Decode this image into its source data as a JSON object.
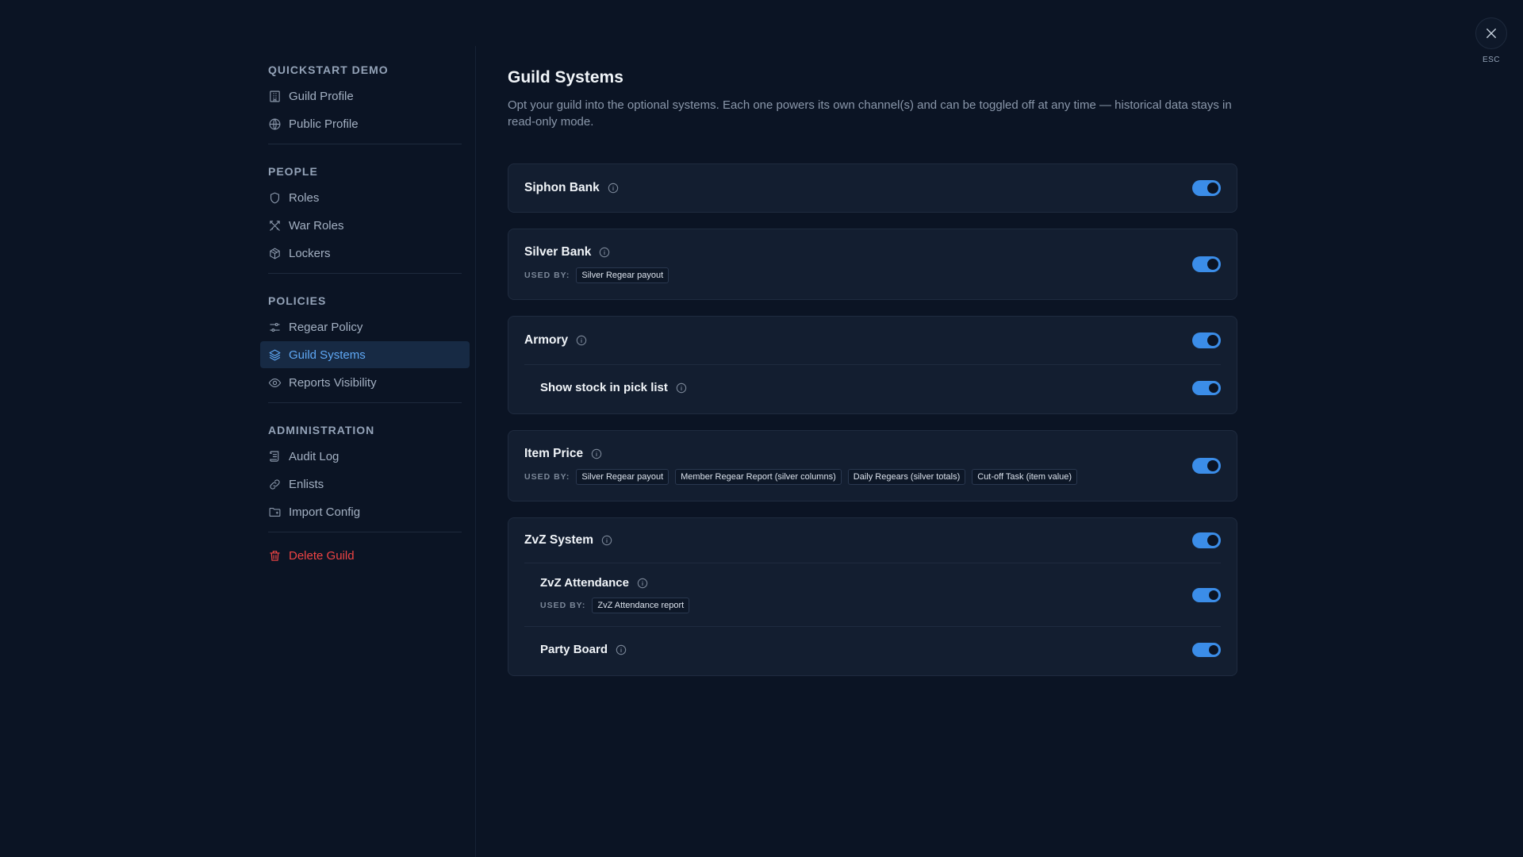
{
  "close": {
    "esc_label": "ESC"
  },
  "sidebar": {
    "sections": [
      {
        "title": "QUICKSTART DEMO",
        "items": [
          {
            "label": "Guild Profile",
            "icon": "building-icon"
          },
          {
            "label": "Public Profile",
            "icon": "globe-icon"
          }
        ]
      },
      {
        "title": "PEOPLE",
        "items": [
          {
            "label": "Roles",
            "icon": "shield-icon"
          },
          {
            "label": "War Roles",
            "icon": "swords-icon"
          },
          {
            "label": "Lockers",
            "icon": "box-icon"
          }
        ]
      },
      {
        "title": "POLICIES",
        "items": [
          {
            "label": "Regear Policy",
            "icon": "sliders-icon"
          },
          {
            "label": "Guild Systems",
            "icon": "layers-icon",
            "active": true
          },
          {
            "label": "Reports Visibility",
            "icon": "eye-icon"
          }
        ]
      },
      {
        "title": "ADMINISTRATION",
        "items": [
          {
            "label": "Audit Log",
            "icon": "scroll-icon"
          },
          {
            "label": "Enlists",
            "icon": "link-icon"
          },
          {
            "label": "Import Config",
            "icon": "folder-icon"
          }
        ]
      }
    ],
    "delete_label": "Delete Guild"
  },
  "main": {
    "title": "Guild Systems",
    "description": "Opt your guild into the optional systems. Each one powers its own channel(s) and can be toggled off at any time — historical data stays in read-only mode.",
    "used_by_label": "USED BY:",
    "systems": {
      "siphon_bank": {
        "name": "Siphon Bank",
        "enabled": true
      },
      "silver_bank": {
        "name": "Silver Bank",
        "enabled": true,
        "used_by": [
          "Silver Regear payout"
        ]
      },
      "armory": {
        "name": "Armory",
        "enabled": true,
        "sub": {
          "name": "Show stock in pick list",
          "enabled": true
        }
      },
      "item_price": {
        "name": "Item Price",
        "enabled": true,
        "used_by": [
          "Silver Regear payout",
          "Member Regear Report (silver columns)",
          "Daily Regears (silver totals)",
          "Cut-off Task (item value)"
        ]
      },
      "zvz_system": {
        "name": "ZvZ System",
        "enabled": true,
        "attendance": {
          "name": "ZvZ Attendance",
          "enabled": true,
          "used_by": [
            "ZvZ Attendance report"
          ]
        },
        "party_board": {
          "name": "Party Board",
          "enabled": true
        }
      }
    }
  },
  "colors": {
    "accent": "#3b8de8",
    "active_nav": "#5fa8f5",
    "danger": "#ef4444"
  }
}
